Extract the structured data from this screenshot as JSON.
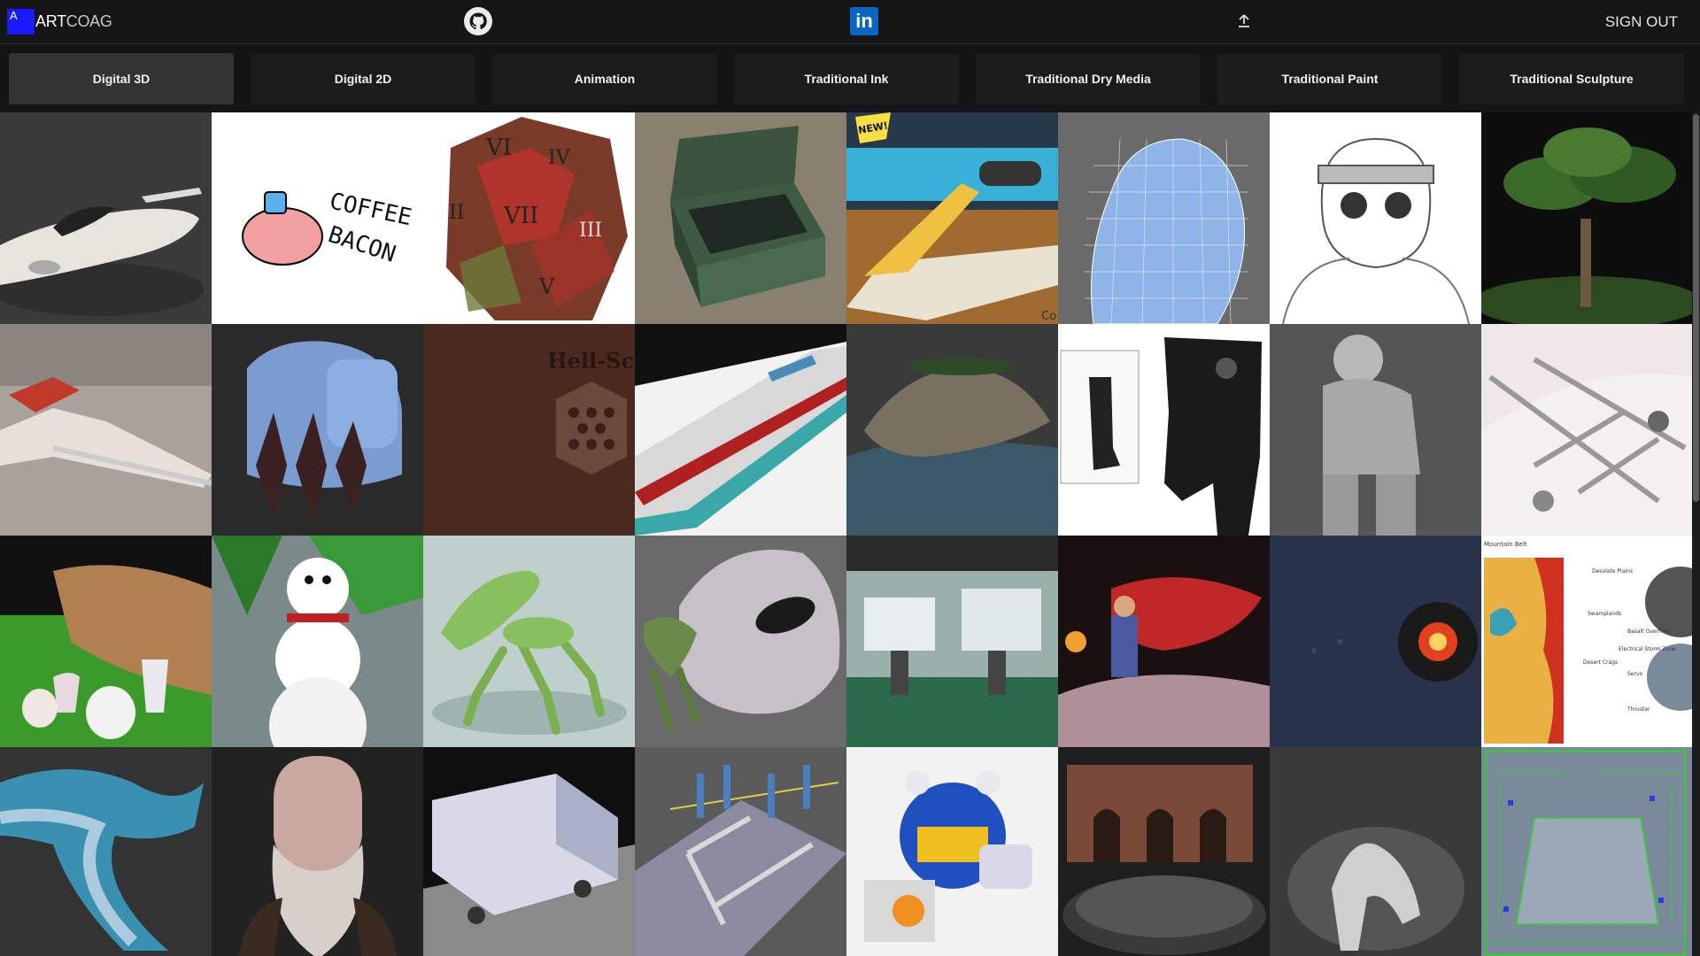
{
  "header": {
    "logo_badge": "A",
    "logo_text_primary": "ART",
    "logo_text_secondary": "COAG",
    "github_icon": "github-icon",
    "linkedin_icon": "linkedin-icon",
    "linkedin_text": "in",
    "upload_icon": "upload-icon",
    "sign_out_label": "SIGN OUT"
  },
  "tabs": [
    {
      "label": "Digital 3D",
      "active": true
    },
    {
      "label": "Digital 2D",
      "active": false
    },
    {
      "label": "Animation",
      "active": false
    },
    {
      "label": "Traditional Ink",
      "active": false
    },
    {
      "label": "Traditional Dry Media",
      "active": false
    },
    {
      "label": "Traditional Paint",
      "active": false
    },
    {
      "label": "Traditional Sculpture",
      "active": false
    }
  ],
  "gallery": {
    "coffee_bacon_text": [
      "COFFEE",
      "BACON"
    ],
    "new_badge_text": "NEW!",
    "hex_numerals": [
      "VI",
      "IV",
      "VII",
      "III",
      "II",
      "V"
    ],
    "hell_scape_text": "Hell-Scap",
    "jet_ski_partial_text": "Co",
    "map_title": "Mountain Belt",
    "map_labels": [
      "Desolate Plains",
      "Swamplands",
      "Basalt Overflow",
      "Electrical Storm Zone",
      "Desert Crags",
      "Servo",
      "Thruster"
    ]
  },
  "colors": {
    "logo_badge": "#1a1aff",
    "linkedin": "#0a66c2",
    "active_tab": "#333333",
    "tab": "#1b1b1b",
    "background": "#111111"
  }
}
